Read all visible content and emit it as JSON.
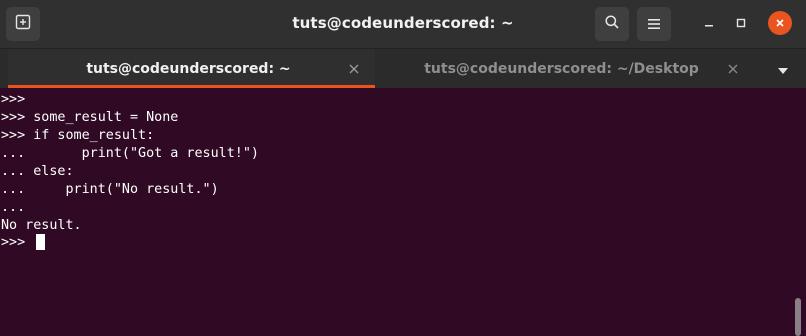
{
  "window": {
    "title": "tuts@codeunderscored: ~",
    "accent_color": "#e95420",
    "terminal_background": "#300a24"
  },
  "header_icons": {
    "new_tab": "new-tab-icon",
    "search": "search-icon",
    "menu": "hamburger-menu-icon",
    "minimize": "minimize-icon",
    "maximize": "maximize-icon",
    "close": "close-icon"
  },
  "tabs": [
    {
      "label": "tuts@codeunderscored: ~",
      "active": true
    },
    {
      "label": "tuts@codeunderscored: ~/Desktop",
      "active": false
    }
  ],
  "terminal": {
    "lines": [
      ">>>",
      ">>> some_result = None",
      ">>> if some_result:",
      "...       print(\"Got a result!\")",
      "... else:",
      "...     print(\"No result.\")",
      "...",
      "No result.",
      ">>> "
    ]
  }
}
